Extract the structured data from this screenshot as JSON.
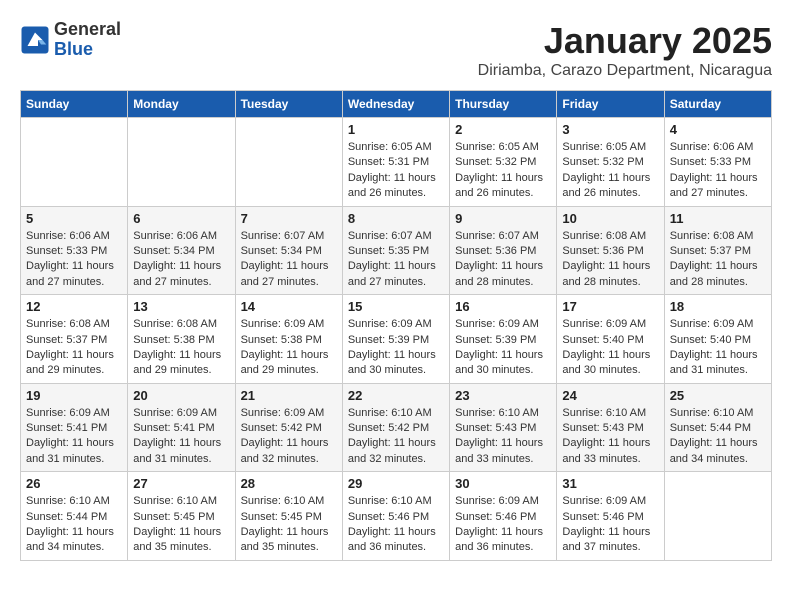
{
  "header": {
    "logo_general": "General",
    "logo_blue": "Blue",
    "month_title": "January 2025",
    "location": "Diriamba, Carazo Department, Nicaragua"
  },
  "weekdays": [
    "Sunday",
    "Monday",
    "Tuesday",
    "Wednesday",
    "Thursday",
    "Friday",
    "Saturday"
  ],
  "weeks": [
    [
      {
        "day": "",
        "info": ""
      },
      {
        "day": "",
        "info": ""
      },
      {
        "day": "",
        "info": ""
      },
      {
        "day": "1",
        "info": "Sunrise: 6:05 AM\nSunset: 5:31 PM\nDaylight: 11 hours\nand 26 minutes."
      },
      {
        "day": "2",
        "info": "Sunrise: 6:05 AM\nSunset: 5:32 PM\nDaylight: 11 hours\nand 26 minutes."
      },
      {
        "day": "3",
        "info": "Sunrise: 6:05 AM\nSunset: 5:32 PM\nDaylight: 11 hours\nand 26 minutes."
      },
      {
        "day": "4",
        "info": "Sunrise: 6:06 AM\nSunset: 5:33 PM\nDaylight: 11 hours\nand 27 minutes."
      }
    ],
    [
      {
        "day": "5",
        "info": "Sunrise: 6:06 AM\nSunset: 5:33 PM\nDaylight: 11 hours\nand 27 minutes."
      },
      {
        "day": "6",
        "info": "Sunrise: 6:06 AM\nSunset: 5:34 PM\nDaylight: 11 hours\nand 27 minutes."
      },
      {
        "day": "7",
        "info": "Sunrise: 6:07 AM\nSunset: 5:34 PM\nDaylight: 11 hours\nand 27 minutes."
      },
      {
        "day": "8",
        "info": "Sunrise: 6:07 AM\nSunset: 5:35 PM\nDaylight: 11 hours\nand 27 minutes."
      },
      {
        "day": "9",
        "info": "Sunrise: 6:07 AM\nSunset: 5:36 PM\nDaylight: 11 hours\nand 28 minutes."
      },
      {
        "day": "10",
        "info": "Sunrise: 6:08 AM\nSunset: 5:36 PM\nDaylight: 11 hours\nand 28 minutes."
      },
      {
        "day": "11",
        "info": "Sunrise: 6:08 AM\nSunset: 5:37 PM\nDaylight: 11 hours\nand 28 minutes."
      }
    ],
    [
      {
        "day": "12",
        "info": "Sunrise: 6:08 AM\nSunset: 5:37 PM\nDaylight: 11 hours\nand 29 minutes."
      },
      {
        "day": "13",
        "info": "Sunrise: 6:08 AM\nSunset: 5:38 PM\nDaylight: 11 hours\nand 29 minutes."
      },
      {
        "day": "14",
        "info": "Sunrise: 6:09 AM\nSunset: 5:38 PM\nDaylight: 11 hours\nand 29 minutes."
      },
      {
        "day": "15",
        "info": "Sunrise: 6:09 AM\nSunset: 5:39 PM\nDaylight: 11 hours\nand 30 minutes."
      },
      {
        "day": "16",
        "info": "Sunrise: 6:09 AM\nSunset: 5:39 PM\nDaylight: 11 hours\nand 30 minutes."
      },
      {
        "day": "17",
        "info": "Sunrise: 6:09 AM\nSunset: 5:40 PM\nDaylight: 11 hours\nand 30 minutes."
      },
      {
        "day": "18",
        "info": "Sunrise: 6:09 AM\nSunset: 5:40 PM\nDaylight: 11 hours\nand 31 minutes."
      }
    ],
    [
      {
        "day": "19",
        "info": "Sunrise: 6:09 AM\nSunset: 5:41 PM\nDaylight: 11 hours\nand 31 minutes."
      },
      {
        "day": "20",
        "info": "Sunrise: 6:09 AM\nSunset: 5:41 PM\nDaylight: 11 hours\nand 31 minutes."
      },
      {
        "day": "21",
        "info": "Sunrise: 6:09 AM\nSunset: 5:42 PM\nDaylight: 11 hours\nand 32 minutes."
      },
      {
        "day": "22",
        "info": "Sunrise: 6:10 AM\nSunset: 5:42 PM\nDaylight: 11 hours\nand 32 minutes."
      },
      {
        "day": "23",
        "info": "Sunrise: 6:10 AM\nSunset: 5:43 PM\nDaylight: 11 hours\nand 33 minutes."
      },
      {
        "day": "24",
        "info": "Sunrise: 6:10 AM\nSunset: 5:43 PM\nDaylight: 11 hours\nand 33 minutes."
      },
      {
        "day": "25",
        "info": "Sunrise: 6:10 AM\nSunset: 5:44 PM\nDaylight: 11 hours\nand 34 minutes."
      }
    ],
    [
      {
        "day": "26",
        "info": "Sunrise: 6:10 AM\nSunset: 5:44 PM\nDaylight: 11 hours\nand 34 minutes."
      },
      {
        "day": "27",
        "info": "Sunrise: 6:10 AM\nSunset: 5:45 PM\nDaylight: 11 hours\nand 35 minutes."
      },
      {
        "day": "28",
        "info": "Sunrise: 6:10 AM\nSunset: 5:45 PM\nDaylight: 11 hours\nand 35 minutes."
      },
      {
        "day": "29",
        "info": "Sunrise: 6:10 AM\nSunset: 5:46 PM\nDaylight: 11 hours\nand 36 minutes."
      },
      {
        "day": "30",
        "info": "Sunrise: 6:09 AM\nSunset: 5:46 PM\nDaylight: 11 hours\nand 36 minutes."
      },
      {
        "day": "31",
        "info": "Sunrise: 6:09 AM\nSunset: 5:46 PM\nDaylight: 11 hours\nand 37 minutes."
      },
      {
        "day": "",
        "info": ""
      }
    ]
  ]
}
